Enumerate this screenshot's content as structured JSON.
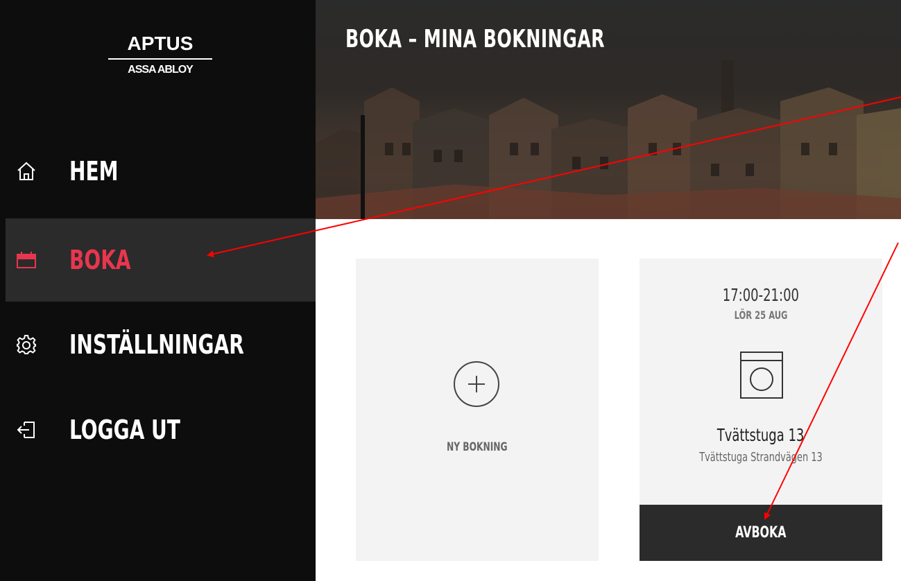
{
  "logo": {
    "top": "APTUS",
    "bottom": "ASSA ABLOY"
  },
  "nav": {
    "items": [
      {
        "label": "HEM",
        "icon": "home-icon"
      },
      {
        "label": "BOKA",
        "icon": "calendar-icon",
        "active": true
      },
      {
        "label": "INSTÄLLNINGAR",
        "icon": "gear-icon"
      },
      {
        "label": "LOGGA UT",
        "icon": "logout-icon"
      }
    ]
  },
  "header": {
    "title": "BOKA – MINA BOKNINGAR"
  },
  "cards": {
    "new_booking": {
      "label": "NY BOKNING",
      "icon": "plus-circle-icon"
    },
    "booking": {
      "time": "17:00-21:00",
      "date": "LÖR 25 AUG",
      "icon": "washing-machine-icon",
      "room": "Tvättstuga 13",
      "address": "Tvättstuga Strandvägen 13",
      "cancel_label": "AVBOKA"
    }
  },
  "colors": {
    "sidebar_bg": "#0d0d0d",
    "active_bg": "#2b2b2b",
    "accent": "#e8364e",
    "card_bg": "#f3f3f3",
    "annotation_arrow": "#ff0000"
  }
}
